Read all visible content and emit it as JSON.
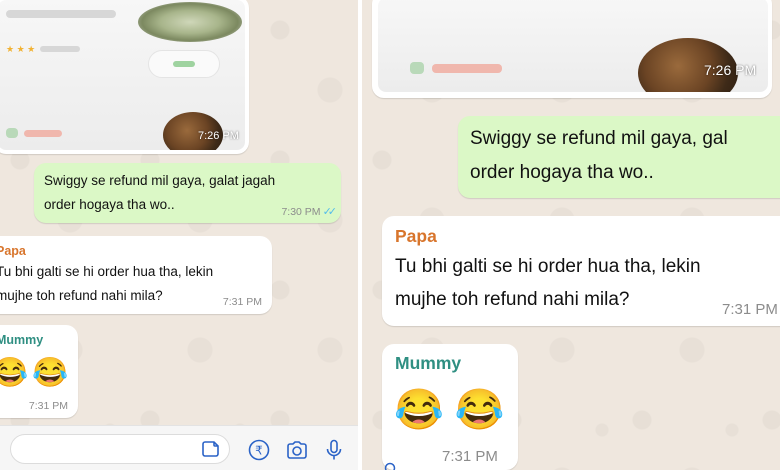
{
  "left_panel": {
    "image_message": {
      "time": "7:26 PM"
    },
    "outgoing": {
      "text_line1": "Swiggy se refund mil gaya, galat jagah",
      "text_line2": "order hogaya tha wo..",
      "time": "7:30 PM"
    },
    "papa_message": {
      "sender": "Papa",
      "text_line1": "Tu bhi galti se hi order hua tha, lekin",
      "text_line2": "mujhe toh refund nahi mila?",
      "time": "7:31 PM"
    },
    "mummy_message": {
      "sender": "Mummy",
      "emojis": "😂😂",
      "time": "7:31 PM"
    },
    "input_bar": {
      "icons": [
        "sticker-icon",
        "rupee-icon",
        "camera-icon",
        "mic-icon"
      ]
    }
  },
  "right_panel": {
    "image_message": {
      "time": "7:26 PM"
    },
    "outgoing": {
      "text_line1": "Swiggy se refund mil gaya, gal",
      "text_line2": "order hogaya tha wo.."
    },
    "papa_message": {
      "sender": "Papa",
      "text_line1": "Tu bhi galti se hi order hua tha, lekin",
      "text_line2": "mujhe toh refund nahi mila?",
      "time": "7:31 PM"
    },
    "mummy_message": {
      "sender": "Mummy",
      "emojis": "😂 😂",
      "time": "7:31 PM"
    }
  },
  "colors": {
    "chat_bg": "#efe7de",
    "outgoing_bubble": "#dbf8c6",
    "papa_name": "#d8752c",
    "mummy_name": "#2f8f82",
    "read_ticks": "#53bdeb"
  }
}
